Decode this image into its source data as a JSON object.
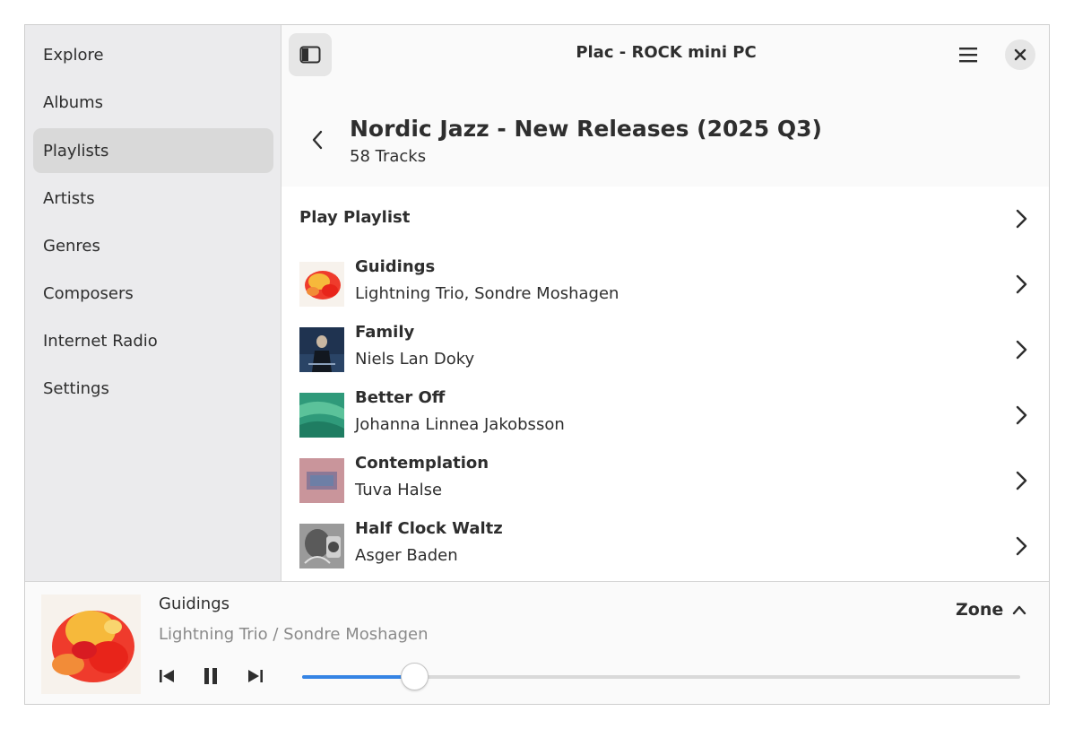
{
  "window": {
    "title": "Plac - ROCK mini PC"
  },
  "sidebar": {
    "items": [
      {
        "label": "Explore"
      },
      {
        "label": "Albums"
      },
      {
        "label": "Playlists",
        "active": true
      },
      {
        "label": "Artists"
      },
      {
        "label": "Genres"
      },
      {
        "label": "Composers"
      },
      {
        "label": "Internet Radio"
      },
      {
        "label": "Settings"
      }
    ]
  },
  "header": {
    "sidebar_toggle_icon": "sidebar-toggle-icon",
    "menu_icon": "hamburger-menu-icon",
    "close_icon": "close-icon",
    "back_icon": "chevron-left-icon"
  },
  "playlist": {
    "title": "Nordic Jazz - New Releases (2025 Q3)",
    "subtitle": "58 Tracks",
    "play_label": "Play Playlist",
    "tracks": [
      {
        "title": "Guidings",
        "artist": "Lightning Trio, Sondre Moshagen"
      },
      {
        "title": "Family",
        "artist": "Niels Lan Doky"
      },
      {
        "title": "Better Off",
        "artist": "Johanna Linnea Jakobsson"
      },
      {
        "title": "Contemplation",
        "artist": "Tuva Halse"
      },
      {
        "title": "Half Clock Waltz",
        "artist": "Asger Baden"
      }
    ]
  },
  "player": {
    "title": "Guidings",
    "artist": "Lightning Trio / Sondre Moshagen",
    "zone_label": "Zone",
    "progress": 0.157,
    "controls": [
      "previous-icon",
      "pause-icon",
      "next-icon"
    ]
  },
  "colors": {
    "accent": "#3584e4",
    "sidebar_bg": "#ebebed",
    "active_item": "#d9d9d9"
  }
}
